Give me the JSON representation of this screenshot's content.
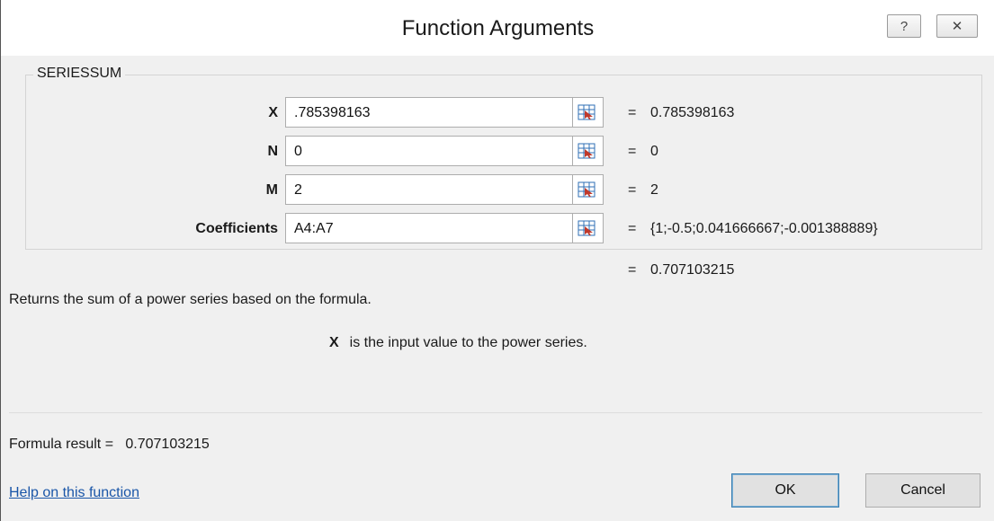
{
  "window": {
    "title": "Function Arguments",
    "help_glyph": "?",
    "close_glyph": "✕"
  },
  "function": {
    "name": "SERIESSUM",
    "arguments": [
      {
        "label": "X",
        "value": ".785398163",
        "evaluated": "0.785398163"
      },
      {
        "label": "N",
        "value": "0",
        "evaluated": "0"
      },
      {
        "label": "M",
        "value": "2",
        "evaluated": "2"
      },
      {
        "label": "Coefficients",
        "value": "A4:A7",
        "evaluated": "{1;-0.5;0.041666667;-0.001388889}"
      }
    ],
    "result_equals": "=",
    "result_value": "0.707103215",
    "description": "Returns the sum of a power series based on the formula.",
    "arg_help_name": "X",
    "arg_help_text": "is the input value to the power series."
  },
  "footer": {
    "formula_result_label": "Formula result =",
    "formula_result_value": "0.707103215",
    "help_link": "Help on this function",
    "ok_label": "OK",
    "cancel_label": "Cancel"
  },
  "icons": {
    "ref_button": "range-select-icon",
    "colors": {
      "ref_red": "#c0392b",
      "ref_blue": "#2f6fb5",
      "link": "#1a56a8"
    }
  }
}
